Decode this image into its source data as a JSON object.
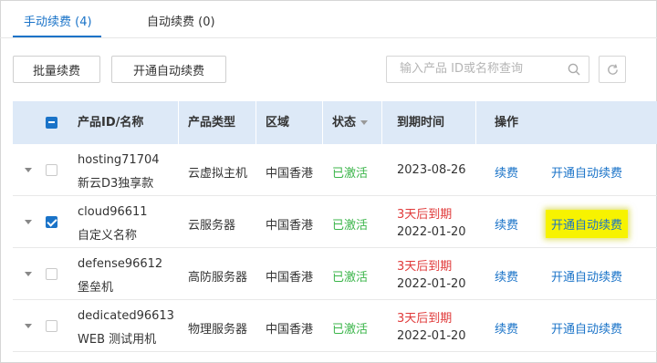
{
  "tabs": [
    {
      "label": "手动续费 (4)",
      "active": true
    },
    {
      "label": "自动续费 (0)",
      "active": false
    }
  ],
  "toolbar": {
    "batch_renew": "批量续费",
    "enable_auto_renew": "开通自动续费",
    "search_placeholder": "输入产品 ID或名称查询",
    "search_icon": "search-icon",
    "refresh_icon": "refresh-icon"
  },
  "table": {
    "headers": {
      "product": "产品ID/名称",
      "type": "产品类型",
      "region": "区域",
      "status": "状态",
      "expiry": "到期时间",
      "actions": "操作"
    },
    "rows": [
      {
        "id": "hosting71704",
        "name": "新云D3独享款",
        "type": "云虚拟主机",
        "region": "中国香港",
        "status": "已激活",
        "warning": "",
        "expiry": "2023-08-26",
        "renew": "续费",
        "auto_renew": "开通自动续费",
        "checked": false
      },
      {
        "id": "cloud96611",
        "name": "自定义名称",
        "type": "云服务器",
        "region": "中国香港",
        "status": "已激活",
        "warning": "3天后到期",
        "expiry": "2022-01-20",
        "renew": "续费",
        "auto_renew": "开通自动续费",
        "checked": true,
        "highlighted": true
      },
      {
        "id": "defense96612",
        "name": "堡垒机",
        "type": "高防服务器",
        "region": "中国香港",
        "status": "已激活",
        "warning": "3天后到期",
        "expiry": "2022-01-20",
        "renew": "续费",
        "auto_renew": "开通自动续费",
        "checked": false
      },
      {
        "id": "dedicated96613",
        "name": "WEB 测试用机",
        "type": "物理服务器",
        "region": "中国香港",
        "status": "已激活",
        "warning": "3天后到期",
        "expiry": "2022-01-20",
        "renew": "续费",
        "auto_renew": "开通自动续费",
        "checked": false
      }
    ]
  },
  "colors": {
    "accent": "#1a73c8",
    "active_status": "#3bb54a",
    "warning": "#e03a3a",
    "header_bg": "#dde9f7",
    "highlight": "#f7f300"
  }
}
